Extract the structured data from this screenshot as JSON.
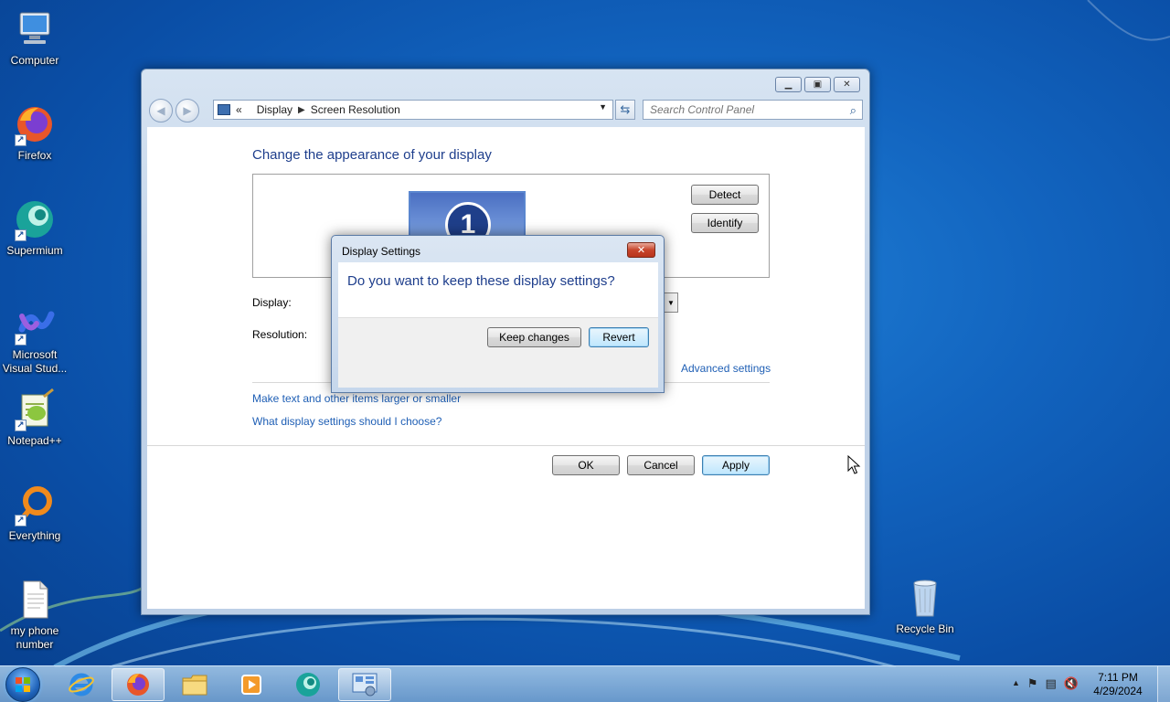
{
  "desktop": {
    "icons": [
      {
        "label": "Computer",
        "icon": "computer-icon"
      },
      {
        "label": "Firefox",
        "icon": "firefox-icon"
      },
      {
        "label": "Supermium",
        "icon": "supermium-icon"
      },
      {
        "label": "Microsoft Visual Stud...",
        "icon": "visual-studio-icon"
      },
      {
        "label": "Notepad++",
        "icon": "notepad-plus-plus-icon"
      },
      {
        "label": "Everything",
        "icon": "everything-search-icon"
      },
      {
        "label": "my phone number",
        "icon": "text-file-icon"
      },
      {
        "label": "Recycle Bin",
        "icon": "recycle-bin-icon"
      }
    ]
  },
  "window": {
    "breadcrumb_prefix": "«",
    "breadcrumb": [
      "Display",
      "Screen Resolution"
    ],
    "search_placeholder": "Search Control Panel",
    "heading": "Change the appearance of your display",
    "monitor_number": "1",
    "detect_label": "Detect",
    "identify_label": "Identify",
    "display_label": "Display:",
    "resolution_label": "Resolution:",
    "advanced_link": "Advanced settings",
    "links": [
      "Make text and other items larger or smaller",
      "What display settings should I choose?"
    ],
    "ok_label": "OK",
    "cancel_label": "Cancel",
    "apply_label": "Apply"
  },
  "dialog": {
    "title": "Display Settings",
    "message": "Do you want to keep these display settings?",
    "keep_label": "Keep changes",
    "revert_label": "Revert",
    "close_glyph": "✕"
  },
  "taskbar": {
    "items": [
      "internet-explorer-icon",
      "firefox-icon",
      "file-explorer-icon",
      "media-player-icon",
      "supermium-icon",
      "control-panel-icon"
    ],
    "active_item": "control-panel-icon",
    "time": "7:11 PM",
    "date": "4/29/2024"
  },
  "colors": {
    "heading": "#1e3e8c",
    "link": "#1f5fb5",
    "desktop": "#1264bf"
  }
}
